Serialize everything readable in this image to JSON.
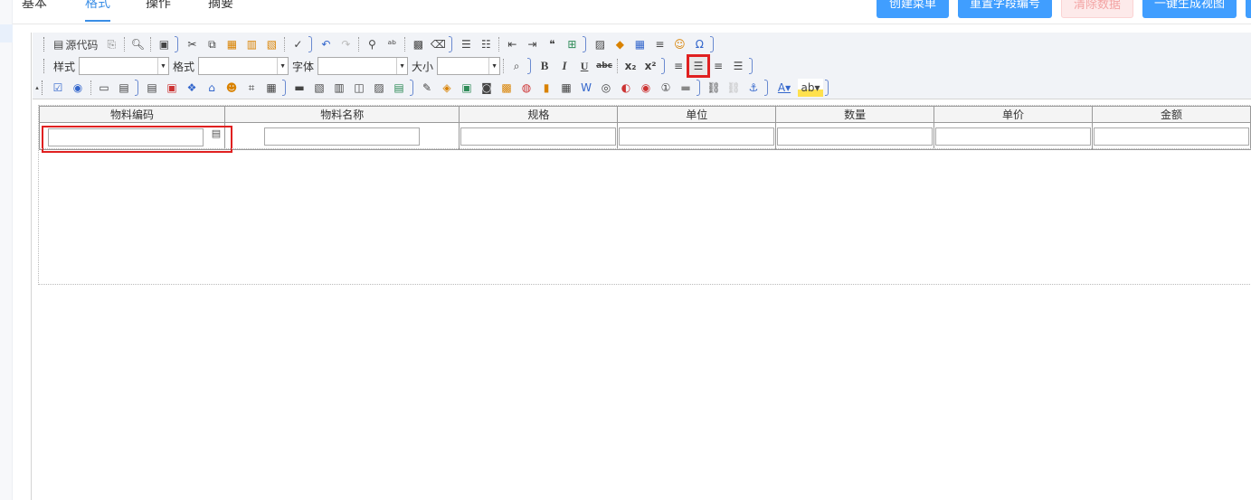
{
  "tabs": [
    "基本",
    "格式",
    "操作",
    "摘要"
  ],
  "active_tab": "格式",
  "top_buttons": {
    "create_menu": "创建菜单",
    "reset_field_numbers": "重置字段编号",
    "clear_data": "清除数据",
    "generate_view": "一键生成视图"
  },
  "toolbar": {
    "source_code": "源代码",
    "style_label": "样式",
    "format_label": "格式",
    "font_label": "字体",
    "size_label": "大小",
    "style_value": "",
    "format_value": "",
    "font_value": "",
    "size_value": "",
    "highlighted_button": "align-center"
  },
  "table": {
    "headers": [
      "物料编码",
      "物料名称",
      "规格",
      "单位",
      "数量",
      "单价",
      "金额"
    ],
    "row_values": [
      "",
      "",
      "",
      "",
      "",
      "",
      ""
    ]
  },
  "colors": {
    "accent": "#409eff",
    "highlight": "#e02020"
  }
}
